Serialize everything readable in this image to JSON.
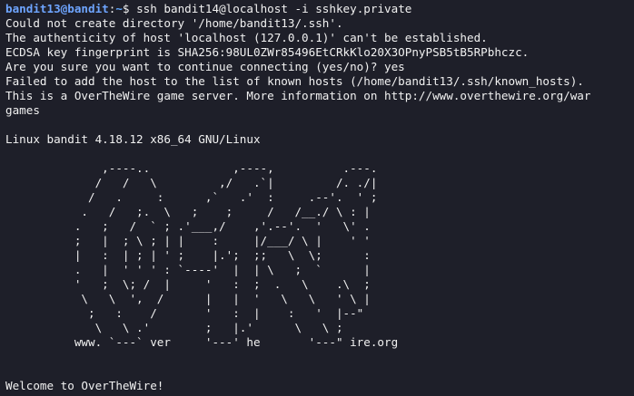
{
  "prompt": {
    "user_host": "bandit13@bandit",
    "separator": ":",
    "path": "~",
    "symbol": "$ ",
    "command": "ssh bandit14@localhost -i sshkey.private"
  },
  "output": [
    "Could not create directory '/home/bandit13/.ssh'.",
    "The authenticity of host 'localhost (127.0.0.1)' can't be established.",
    "ECDSA key fingerprint is SHA256:98UL0ZWr85496EtCRkKlo20X3OPnyPSB5tB5RPbhczc.",
    "Are you sure you want to continue connecting (yes/no)? yes",
    "Failed to add the host to the list of known hosts (/home/bandit13/.ssh/known_hosts).",
    "This is a OverTheWire game server. More information on http://www.overthewire.org/war",
    "games"
  ],
  "system_line": "Linux bandit 4.18.12 x86_64 GNU/Linux",
  "ascii_art": [
    "              ,----..            ,----,          .---.",
    "             /   /   \\         ,/   .`|         /. ./|",
    "            /   .     :      ,`   .'  :     .--'.  ' ;",
    "           .   /   ;.  \\   ;    ;     /   /__./ \\ : |",
    "          .   ;   /  ` ; .'___,/    ,'.--'.  '   \\' .",
    "          ;   |  ; \\ ; | |    :     |/___/ \\ |    ' '",
    "          |   :  | ; | ' ;    |.';  ;;   \\  \\;      :",
    "          .   |  ' ' ' : `----'  |  | \\   ;  `      |",
    "          '   ;  \\; /  |     '   :  ;  .   \\    .\\  ;",
    "           \\   \\  ',  /      |   |  '   \\   \\   ' \\ |",
    "            ;   :    /       '   :  |    :   '  |--\"",
    "             \\   \\ .'        ;   |.'      \\   \\ ;",
    "          www. `---` ver     '---' he       '---\" ire.org"
  ],
  "welcome": "Welcome to OverTheWire!"
}
